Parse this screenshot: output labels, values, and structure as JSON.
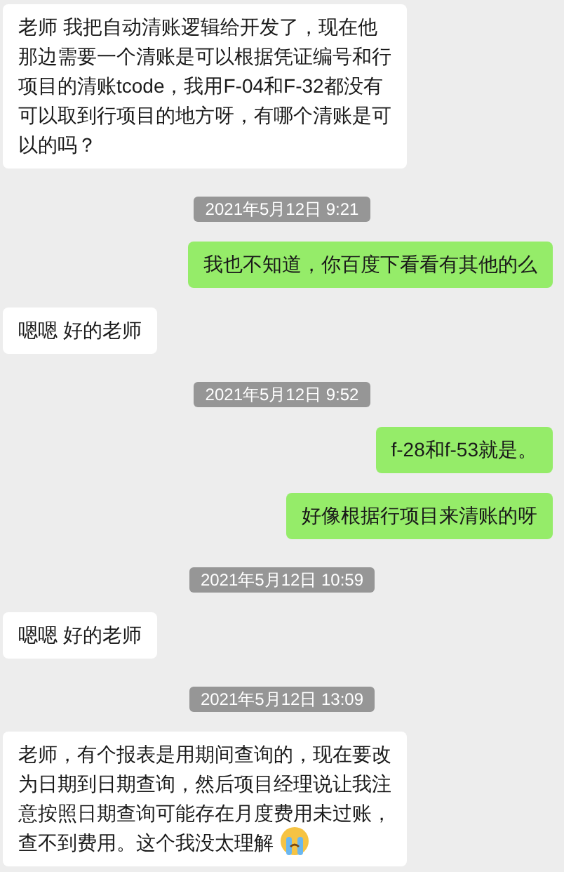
{
  "messages": [
    {
      "kind": "received",
      "text": "老师  我把自动清账逻辑给开发了，现在他那边需要一个清账是可以根据凭证编号和行项目的清账tcode，我用F-04和F-32都没有可以取到行项目的地方呀，有哪个清账是可以的吗？"
    },
    {
      "kind": "time",
      "text": "2021年5月12日 9:21"
    },
    {
      "kind": "sent",
      "text": "我也不知道，你百度下看看有其他的么"
    },
    {
      "kind": "received",
      "text": "嗯嗯  好的老师"
    },
    {
      "kind": "time",
      "text": "2021年5月12日 9:52"
    },
    {
      "kind": "sent",
      "text": "f-28和f-53就是。"
    },
    {
      "kind": "sent",
      "text": "好像根据行项目来清账的呀"
    },
    {
      "kind": "time",
      "text": "2021年5月12日 10:59"
    },
    {
      "kind": "received",
      "text": "嗯嗯  好的老师"
    },
    {
      "kind": "time",
      "text": "2021年5月12日 13:09"
    },
    {
      "kind": "received",
      "text": "老师，有个报表是用期间查询的，现在要改为日期到日期查询，然后项目经理说让我注意按照日期查询可能存在月度费用未过账，查不到费用。这个我没太理解",
      "emoji": true
    }
  ]
}
